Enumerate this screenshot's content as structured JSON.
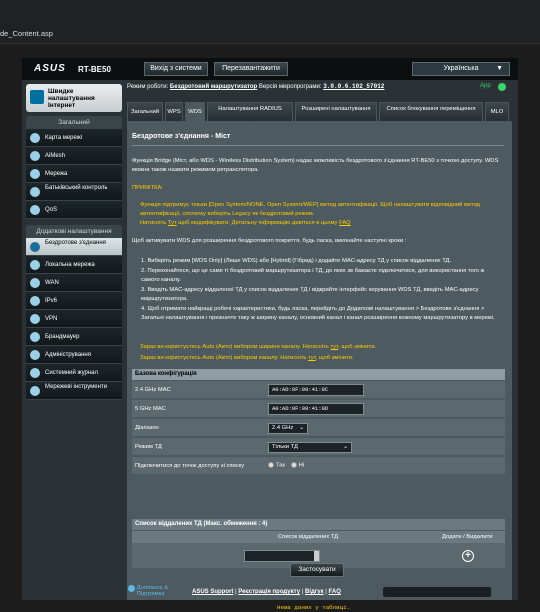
{
  "browser": {
    "url_fragment": "de_Content.asp"
  },
  "header": {
    "brand": "ASUS",
    "model": "RT-BE50",
    "logout": "Вихід з системи",
    "reboot": "Перезавантажити",
    "language": "Українська"
  },
  "status": {
    "mode_label": "Режим роботи:",
    "mode_value": "Бездротовий маршрутизатор",
    "fw_label": "Версія мікропрограми:",
    "fw_value": "3.0.0.6.102_57012",
    "app_label": "App"
  },
  "sidebar": {
    "quick_setup": "Швидке налаштування Інтернет",
    "general_header": "Загальний",
    "general": [
      {
        "label": "Карта мережі"
      },
      {
        "label": "AiMesh"
      },
      {
        "label": "Мережа"
      },
      {
        "label": "Батьківський контроль"
      },
      {
        "label": "QoS"
      }
    ],
    "advanced_header": "Додаткові налаштування",
    "advanced": [
      {
        "label": "Бездротове з'єднання"
      },
      {
        "label": "Локальна мережа"
      },
      {
        "label": "WAN"
      },
      {
        "label": "IPv6"
      },
      {
        "label": "VPN"
      },
      {
        "label": "Брандмауер"
      },
      {
        "label": "Адміністрування"
      },
      {
        "label": "Системний журнал"
      },
      {
        "label": "Мережеві інструменти"
      }
    ]
  },
  "tabs": [
    "Загальний",
    "WPS",
    "WDS",
    "Налаштування RADIUS",
    "Розширені налаштування",
    "Список блокування переміщення",
    "MLO"
  ],
  "page": {
    "title": "Бездротове з'єднання - Міст",
    "intro": "Функція Bridge (Міст, або WDS - Wireless Distribution System) надає можливість бездротового з'єднання RT-BE50 з точкою доступу. WDS можна також назвати режимом ретранслятора.",
    "note_title": "ПРИМІТКА:",
    "note_1": "Функція підтримує тільки [Open System/NONE, Open System/WEP] метод автентифікації. Щоб налаштувати відповідний метод автентифікації, спочатку виберіть Legacy як бездротовий режим.",
    "note_2a": "Натисніть ",
    "note_2_link": "Тут",
    "note_2b": " щоб модифікувати. Детальну інформацію дивіться в цьому ",
    "note_2_faq": "FAQ",
    "steps_intro": "Щоб активувати WDS для розширення бездротового покриття, будь ласка, виконайте наступні кроки :",
    "step_1": "1. Виберіть режим [WDS Only] (Лише WDS) або [Hybrid] (Гібрид) і додайте MAC-адресу ТД у список віддалених ТД.",
    "step_2": "2. Переконайтеся, що це саме ті бездротовий маршрутизатора і ТД, до яких зв бажаєте підключитися, для використання того ж самого каналу.",
    "step_3": "3. Введіть MAC-адресу віддаленої ТД у список віддалених ТД і відкрийте інтерфейс керування WDS ТД, введіть MAC-адресу маршрутизатора.",
    "step_4": "4. Щоб отримати найкращі робочі характеристики, будь ласка, перейдіть до Додаткові налаштування > Бездротове з'єднання > Загальні налаштування і призначте таку ж ширину каналу, основний канал і канал розширення кожному маршрутизатору в мережі.",
    "now_1a": "Зараз ви користуєтесь Auto (Авто) вибором ширини каналу. Натисніть ",
    "now_1_link": "тут",
    "now_1b": ", щоб змінити.",
    "now_2a": "Зараз ви користуєтесь Auto (Авто) вибором каналу. Натисніть ",
    "now_2_link": "тут",
    "now_2b": ", щоб змінити."
  },
  "config": {
    "header": "Базова конфігурація",
    "mac24_label": "2.4 GHz MAC",
    "mac24_value": "A0:AD:9F:09:41:0C",
    "mac5_label": "5 GHz MAC",
    "mac5_value": "A0:AD:9F:09:41:0D",
    "band_label": "Діапазон",
    "band_value": "2.4 GHz",
    "mode_label": "Режим ТД",
    "mode_value": "Тільки ТД",
    "connect_label": "Підключитися до точок доступу зі списку",
    "yes": "Так",
    "no": "Ні"
  },
  "remote": {
    "header": "Список віддалених ТД (Макс. обмеження : 4)",
    "col_list": "Список віддалених ТД",
    "col_action": "Додати / Видалити",
    "empty": "Нема даних у таблиці.",
    "apply": "Застосувати"
  },
  "footer": {
    "help": "Допомога & Підтримка",
    "support": "ASUS Support",
    "product_reg": "Реєстрація продукту",
    "feedback": "Відгук",
    "faq": "FAQ"
  }
}
